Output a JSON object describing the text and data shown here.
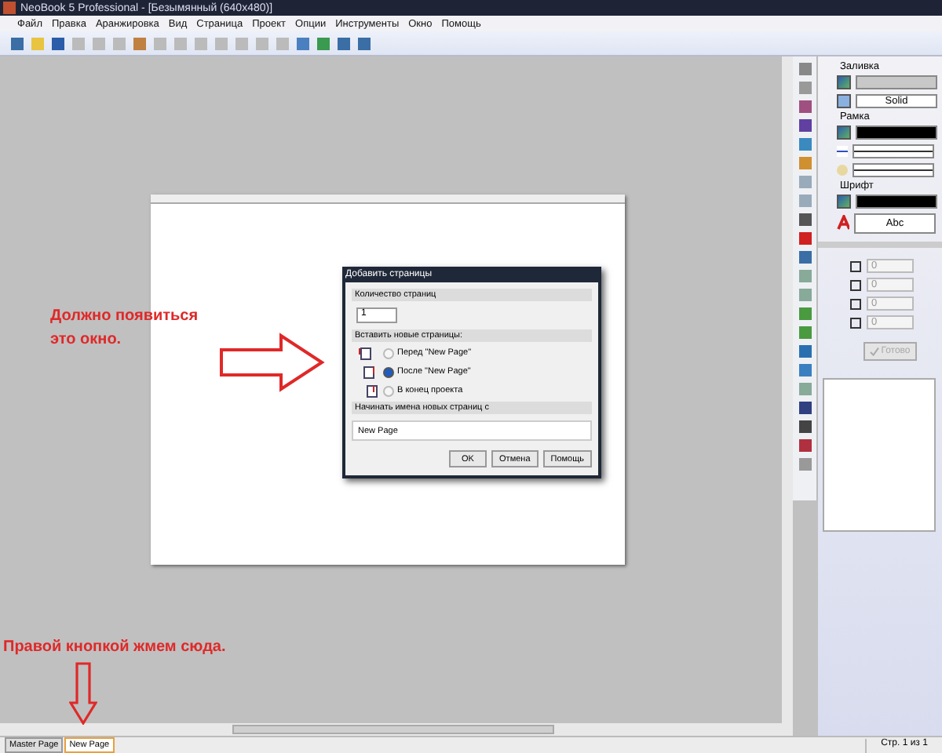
{
  "window": {
    "title": "NeoBook 5 Professional - [Безымянный (640x480)]"
  },
  "menu": [
    "Файл",
    "Правка",
    "Аранжировка",
    "Вид",
    "Страница",
    "Проект",
    "Опции",
    "Инструменты",
    "Окно",
    "Помощь"
  ],
  "properties": {
    "fill_label": "Заливка",
    "fill_style": "Solid",
    "border_label": "Рамка",
    "font_label": "Шрифт",
    "font_sample": "Abc"
  },
  "position": {
    "fields": [
      {
        "value": "0",
        "disabled": true
      },
      {
        "value": "0",
        "disabled": true
      },
      {
        "value": "0",
        "disabled": true
      },
      {
        "value": "0",
        "disabled": true
      }
    ],
    "apply_button": {
      "label": "Готово",
      "disabled": true
    }
  },
  "dialog": {
    "title": "Добавить страницы",
    "count_label": "Количество страниц",
    "count_value": "1",
    "insert_label": "Вставить новые страницы:",
    "options": [
      {
        "label": "Перед \"New Page\"",
        "selected": false
      },
      {
        "label": "После \"New Page\"",
        "selected": true
      },
      {
        "label": "В конец проекта",
        "selected": false
      }
    ],
    "name_label": "Начинать имена новых страниц с",
    "name_value": "New Page",
    "buttons": [
      "OK",
      "Отмена",
      "Помощь"
    ]
  },
  "annotations": [
    "Должно появиться это окно.",
    "Правой кнопкой жмем сюда."
  ],
  "page_tabs": [
    {
      "label": "Master Page",
      "selected": false
    },
    {
      "label": "New Page",
      "selected": true
    }
  ],
  "status_bar": "Стр. 1 из 1"
}
